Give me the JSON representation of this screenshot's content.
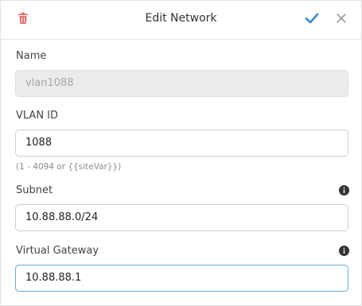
{
  "header": {
    "title": "Edit Network",
    "delete_icon": "trash-icon",
    "confirm_icon": "checkmark-icon",
    "close_icon": "close-icon"
  },
  "fields": {
    "name": {
      "label": "Name",
      "value": "vlan1088",
      "disabled": true
    },
    "vlan_id": {
      "label": "VLAN ID",
      "value": "1088",
      "hint": "(1 - 4094 or {{siteVar}})"
    },
    "subnet": {
      "label": "Subnet",
      "value": "10.88.88.0/24",
      "info_icon": "info-icon"
    },
    "virtual_gateway": {
      "label": "Virtual Gateway",
      "value": "10.88.88.1",
      "info_icon": "info-icon"
    }
  },
  "colors": {
    "delete": "#e06b6b",
    "confirm": "#3c8fd0",
    "focus_border": "#6aa9d6",
    "disabled_bg": "#ececec"
  }
}
